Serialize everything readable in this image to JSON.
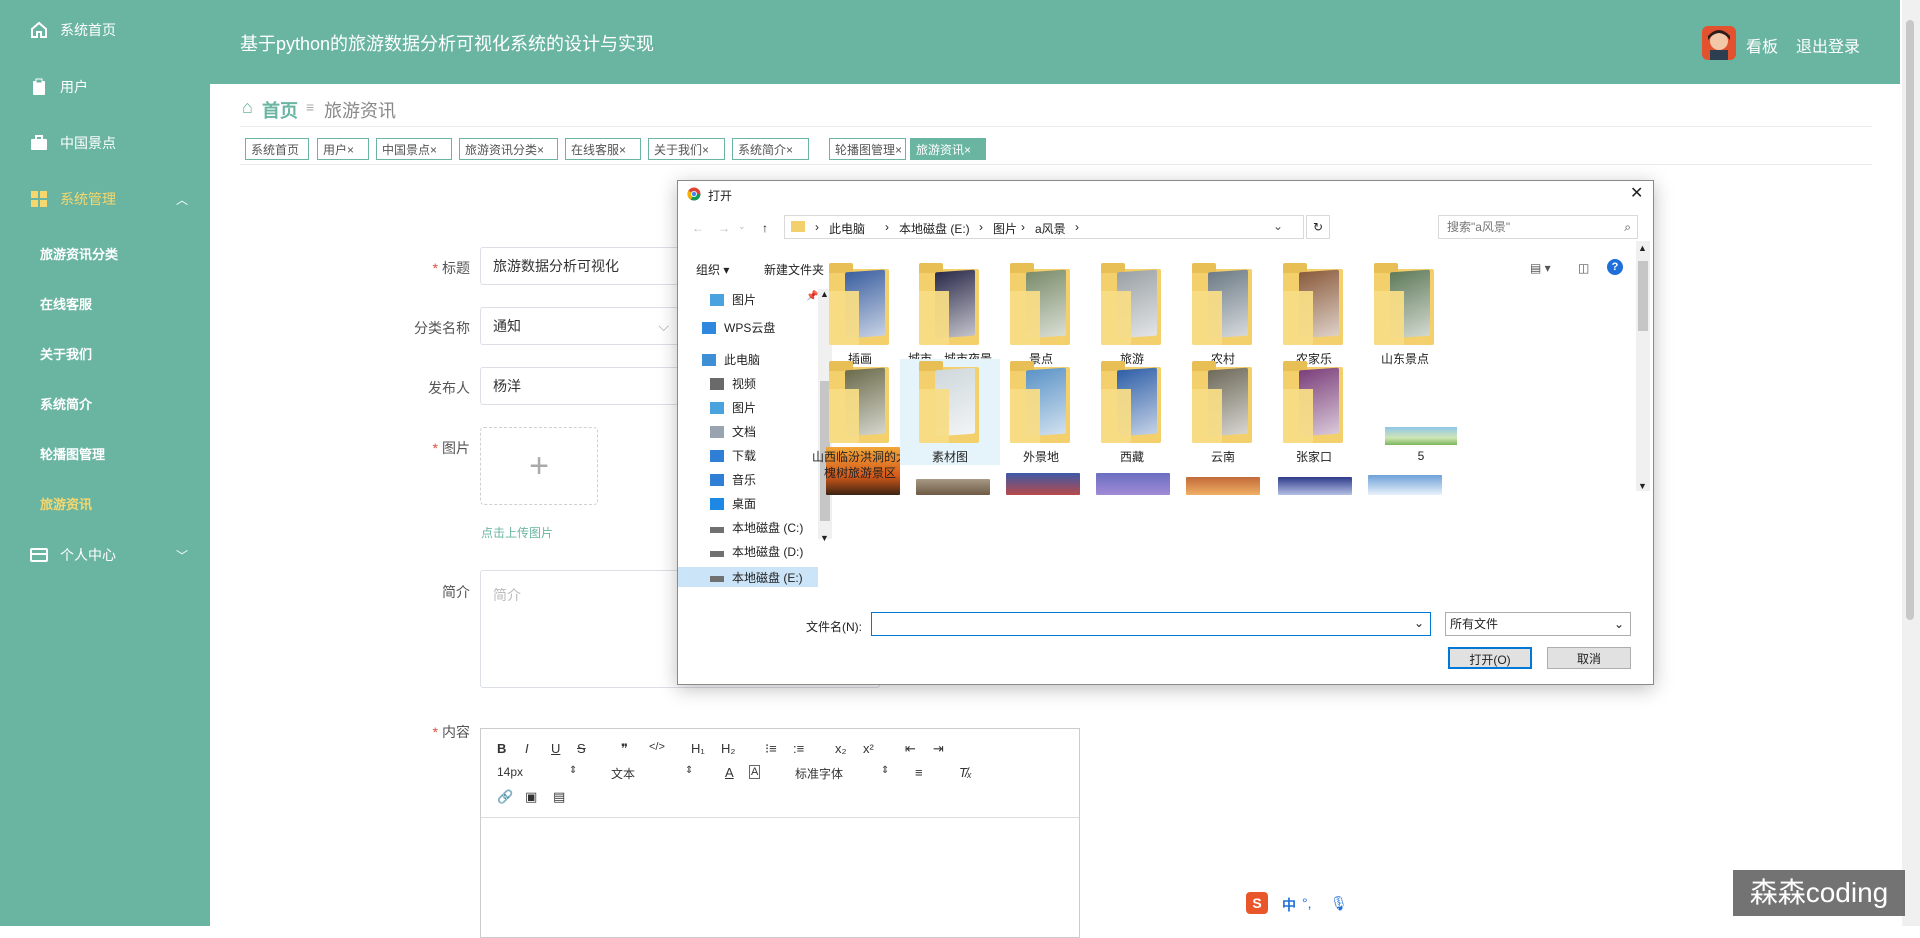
{
  "sidebar": {
    "items": [
      {
        "label": "系统首页",
        "icon": "home-icon"
      },
      {
        "label": "用户",
        "icon": "clipboard-icon"
      },
      {
        "label": "中国景点",
        "icon": "briefcase-icon"
      },
      {
        "label": "系统管理",
        "icon": "grid-icon"
      },
      {
        "label": "个人中心",
        "icon": "card-icon"
      }
    ],
    "subitems": [
      "旅游资讯分类",
      "在线客服",
      "关于我们",
      "系统简介",
      "轮播图管理",
      "旅游资讯"
    ]
  },
  "header": {
    "title": "基于python的旅游数据分析可视化系统的设计与实现",
    "user": "看板",
    "logout": "退出登录"
  },
  "breadcrumb": {
    "home": "首页",
    "separator": "≡",
    "current": "旅游资讯"
  },
  "tags": [
    {
      "label": "系统首页",
      "closable": false
    },
    {
      "label": "用户",
      "closable": true
    },
    {
      "label": "中国景点",
      "closable": true
    },
    {
      "label": "旅游资讯分类",
      "closable": true
    },
    {
      "label": "在线客服",
      "closable": true
    },
    {
      "label": "关于我们",
      "closable": true
    },
    {
      "label": "系统简介",
      "closable": true
    },
    {
      "label": "轮播图管理",
      "closable": true
    },
    {
      "label": "旅游资讯",
      "closable": true,
      "active": true
    }
  ],
  "form": {
    "title_label": "标题",
    "title_value": "旅游数据分析可视化",
    "category_label": "分类名称",
    "category_value": "通知",
    "publisher_label": "发布人",
    "publisher_value": "杨洋",
    "image_label": "图片",
    "upload_hint": "点击上传图片",
    "summary_label": "简介",
    "summary_placeholder": "简介",
    "content_label": "内容"
  },
  "editor": {
    "font_size": "14px",
    "block_type": "文本",
    "font_family": "标准字体"
  },
  "dialog": {
    "title": "打开",
    "path": [
      "此电脑",
      "本地磁盘 (E:)",
      "图片",
      "a风景"
    ],
    "search_placeholder": "搜索\"a风景\"",
    "organize": "组织",
    "new_folder": "新建文件夹",
    "nav": [
      {
        "label": "图片",
        "icon": "pictures-icon"
      },
      {
        "label": "WPS云盘",
        "icon": "cloud-icon"
      },
      {
        "label": "此电脑",
        "icon": "computer-icon"
      },
      {
        "label": "视频",
        "icon": "video-icon"
      },
      {
        "label": "图片",
        "icon": "pictures-icon"
      },
      {
        "label": "文档",
        "icon": "document-icon"
      },
      {
        "label": "下载",
        "icon": "download-icon"
      },
      {
        "label": "音乐",
        "icon": "music-icon"
      },
      {
        "label": "桌面",
        "icon": "desktop-icon"
      },
      {
        "label": "本地磁盘 (C:)",
        "icon": "drive-icon"
      },
      {
        "label": "本地磁盘 (D:)",
        "icon": "drive-icon"
      },
      {
        "label": "本地磁盘 (E:)",
        "icon": "drive-icon"
      }
    ],
    "folders": [
      {
        "label": "插画",
        "color": "#3b5fa0"
      },
      {
        "label": "城市，城市夜景",
        "color": "#2b2a4a"
      },
      {
        "label": "景点",
        "color": "#7a8c6a"
      },
      {
        "label": "旅游",
        "color": "#9aa1a6"
      },
      {
        "label": "农村",
        "color": "#6d7b86"
      },
      {
        "label": "农家乐",
        "color": "#8a5b3c"
      },
      {
        "label": "山东景点",
        "color": "#5f7a5a"
      },
      {
        "label": "山西临汾洪洞的大槐树旅游景区",
        "color": "#6b6b4c"
      },
      {
        "label": "素材图",
        "color": "#cfd8dc"
      },
      {
        "label": "外景地",
        "color": "#5b93c7"
      },
      {
        "label": "西藏",
        "color": "#2f5fa8"
      },
      {
        "label": "云南",
        "color": "#6f6a5a"
      },
      {
        "label": "张家口",
        "color": "#7b3f7a"
      }
    ],
    "file5": "5",
    "filename_label": "文件名(N):",
    "filetype": "所有文件",
    "open_button": "打开(O)",
    "cancel_button": "取消"
  },
  "watermark": "森森coding",
  "ime": "中"
}
